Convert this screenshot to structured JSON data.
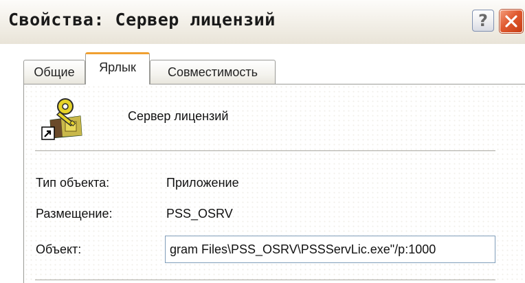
{
  "window": {
    "title": "Свойства: Сервер лицензий",
    "help_label": "?",
    "close_icon": "close-icon"
  },
  "tabs": [
    {
      "label": "Общие",
      "active": false
    },
    {
      "label": "Ярлык",
      "active": true
    },
    {
      "label": "Совместимость",
      "active": false
    }
  ],
  "shortcut": {
    "icon": "key-shortcut-icon",
    "name": "Сервер лицензий",
    "type_label": "Тип объекта:",
    "type_value": "Приложение",
    "location_label": "Размещение:",
    "location_value": "PSS_OSRV",
    "target_label": "Объект:",
    "target_value": "gram Files\\PSS_OSRV\\PSSServLic.exe\"/p:1000"
  },
  "colors": {
    "close_button": "#d9542b",
    "active_tab_accent": "#f0a030",
    "input_border": "#7f9db9"
  }
}
